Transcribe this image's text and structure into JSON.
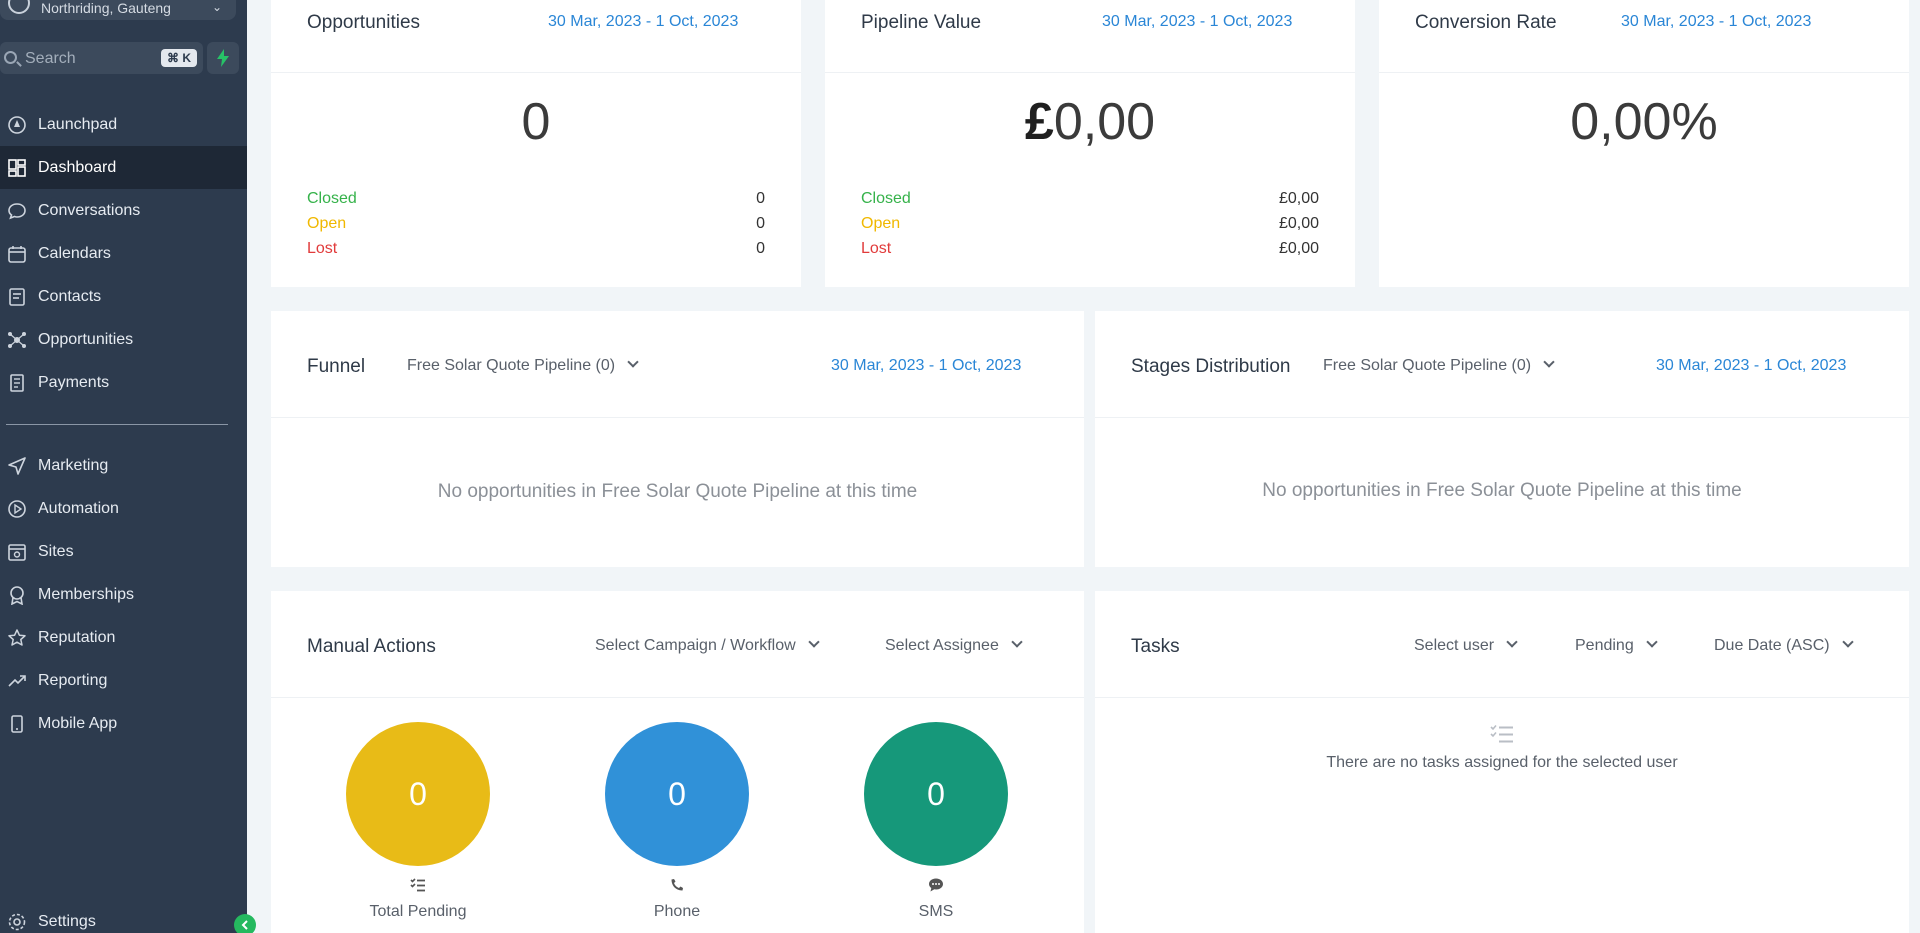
{
  "sidebar": {
    "location": "Northriding, Gauteng",
    "search_placeholder": "Search",
    "search_shortcut": "⌘ K",
    "items_top": [
      {
        "label": "Launchpad",
        "icon": "launchpad-icon"
      },
      {
        "label": "Dashboard",
        "icon": "dashboard-icon",
        "active": true
      },
      {
        "label": "Conversations",
        "icon": "chat-icon"
      },
      {
        "label": "Calendars",
        "icon": "calendar-icon"
      },
      {
        "label": "Contacts",
        "icon": "contacts-icon"
      },
      {
        "label": "Opportunities",
        "icon": "opportunities-icon"
      },
      {
        "label": "Payments",
        "icon": "payments-icon"
      }
    ],
    "items_bottom": [
      {
        "label": "Marketing",
        "icon": "send-icon"
      },
      {
        "label": "Automation",
        "icon": "automation-icon"
      },
      {
        "label": "Sites",
        "icon": "sites-icon"
      },
      {
        "label": "Memberships",
        "icon": "badge-icon"
      },
      {
        "label": "Reputation",
        "icon": "star-icon"
      },
      {
        "label": "Reporting",
        "icon": "trend-icon"
      },
      {
        "label": "Mobile App",
        "icon": "mobile-icon"
      }
    ],
    "settings_label": "Settings"
  },
  "opportunities": {
    "title": "Opportunities",
    "date_range": "30 Mar, 2023 - 1 Oct, 2023",
    "total": "0",
    "closed_label": "Closed",
    "closed_value": "0",
    "open_label": "Open",
    "open_value": "0",
    "lost_label": "Lost",
    "lost_value": "0"
  },
  "pipeline_value": {
    "title": "Pipeline Value",
    "date_range": "30 Mar, 2023 - 1 Oct, 2023",
    "currency": "£",
    "amount": "0,00",
    "closed_label": "Closed",
    "closed_value": "£0,00",
    "open_label": "Open",
    "open_value": "£0,00",
    "lost_label": "Lost",
    "lost_value": "£0,00"
  },
  "conversion_rate": {
    "title": "Conversion Rate",
    "date_range": "30 Mar, 2023 - 1 Oct, 2023",
    "value": "0,00%"
  },
  "funnel": {
    "title": "Funnel",
    "pipeline": "Free Solar Quote Pipeline (0)",
    "date_range": "30 Mar, 2023 - 1 Oct, 2023",
    "empty": "No opportunities in Free Solar Quote Pipeline at this time"
  },
  "stages": {
    "title": "Stages Distribution",
    "pipeline": "Free Solar Quote Pipeline (0)",
    "date_range": "30 Mar, 2023 - 1 Oct, 2023",
    "empty": "No opportunities in Free Solar Quote Pipeline at this time"
  },
  "manual_actions": {
    "title": "Manual Actions",
    "campaign_select": "Select Campaign / Workflow",
    "assignee_select": "Select Assignee",
    "total_pending": {
      "value": "0",
      "label": "Total Pending",
      "color": "#e8bb17"
    },
    "phone": {
      "value": "0",
      "label": "Phone",
      "color": "#3091d8"
    },
    "sms": {
      "value": "0",
      "label": "SMS",
      "color": "#16987a"
    }
  },
  "tasks": {
    "title": "Tasks",
    "user_select": "Select user",
    "status_select": "Pending",
    "sort_select": "Due Date (ASC)",
    "empty": "There are no tasks assigned for the selected user"
  }
}
